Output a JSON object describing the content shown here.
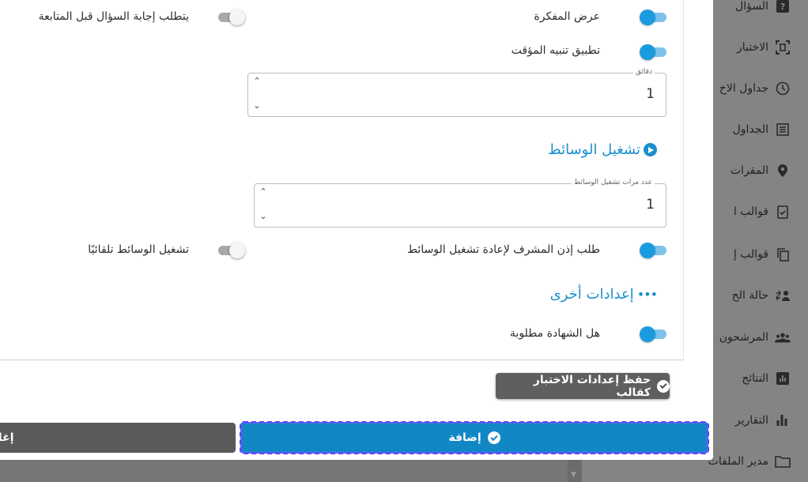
{
  "sidebar": {
    "items": [
      {
        "label": "السؤال",
        "icon": "question-mark-icon"
      },
      {
        "label": "الاختبار",
        "icon": "scan-frame-icon"
      },
      {
        "label": "جداول الاخ",
        "icon": "clock-icon"
      },
      {
        "label": "الجداول",
        "icon": "table-list-icon"
      },
      {
        "label": "المقرات",
        "icon": "location-pin-icon"
      },
      {
        "label": "قوالب ا",
        "icon": "clipboard-check-icon"
      },
      {
        "label": "قوالب إ",
        "icon": "copy-icon"
      },
      {
        "label": "حالة الح",
        "icon": "status-exchange-icon"
      },
      {
        "label": "المرشحون",
        "icon": "people-group-icon"
      },
      {
        "label": "النتائج",
        "icon": "bar-chart-box-icon"
      },
      {
        "label": "التقارير",
        "icon": "bar-chart-icon"
      },
      {
        "label": "مدير الملفات",
        "icon": "folder-icon"
      }
    ]
  },
  "settings": {
    "show_notepad": {
      "label": "عرض المفكرة",
      "on": true
    },
    "require_answer": {
      "label": "يتطلب إجابة السؤال قبل المتابعة",
      "on": false
    },
    "timer_alert": {
      "label": "تطبيق تنبيه المؤقت",
      "on": true
    },
    "minutes_field": {
      "legend": "دقائق",
      "value": "1"
    },
    "media_section_title": "تشغيل الوسائط",
    "media_count_field": {
      "legend": "عدد مرات تشغيل الوسائط",
      "value": "1"
    },
    "supervisor_permission": {
      "label": "طلب إذن المشرف لإعادة تشغيل الوسائط",
      "on": true
    },
    "autoplay_media": {
      "label": "تشغيل الوسائط تلقائيًا",
      "on": false
    },
    "other_section_title": "إعدادات أخرى",
    "certificate_required": {
      "label": "هل الشهادة مطلوبة",
      "on": true
    }
  },
  "buttons": {
    "save_template": "حفظ إعدادات الاختبار كقالب",
    "add": "إضافة",
    "close": "إغلاق"
  },
  "colors": {
    "primary": "#1287c6",
    "accent": "#1b8fcf",
    "toggle_on": "#1a9be0",
    "dark_button": "#5f5f5f"
  }
}
